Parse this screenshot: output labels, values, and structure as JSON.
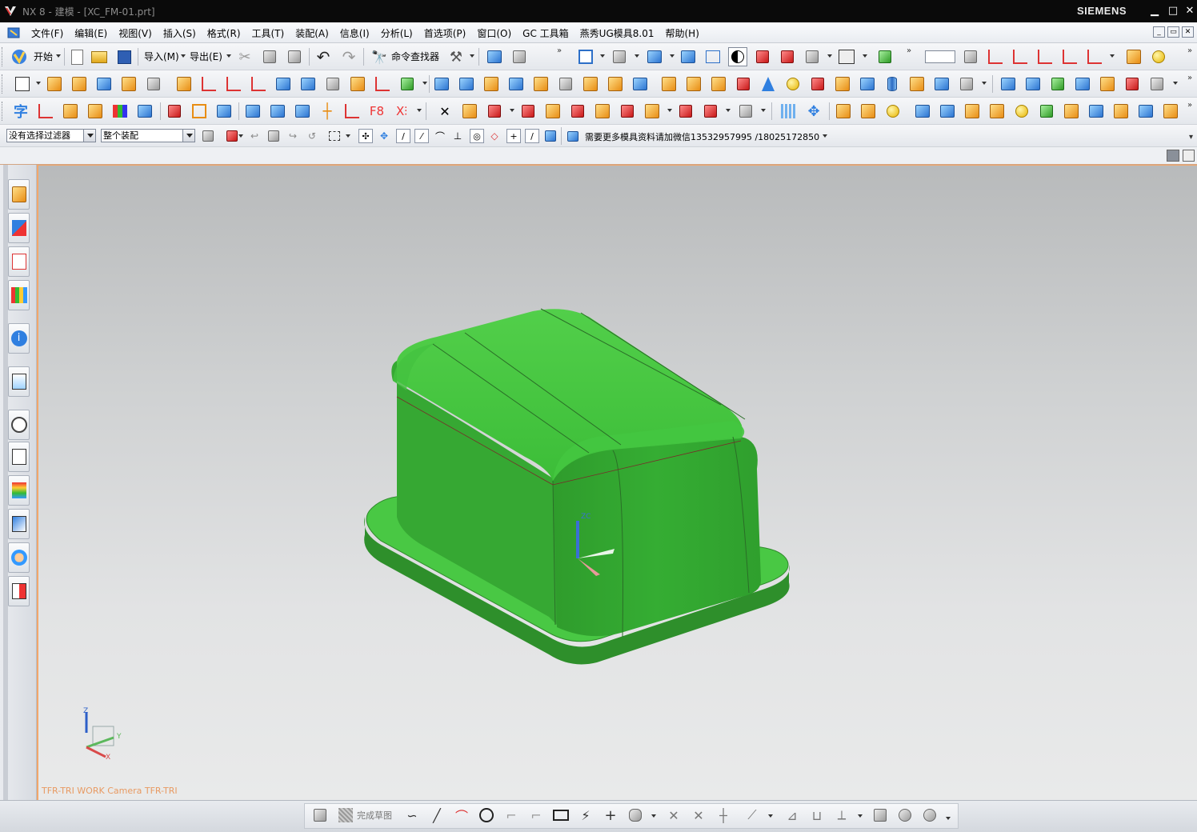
{
  "window": {
    "title": "NX 8 - 建模 - [XC_FM-01.prt]",
    "brand": "SIEMENS",
    "controls": [
      "minimize",
      "maximize",
      "close"
    ]
  },
  "menu": {
    "items": [
      "文件(F)",
      "编辑(E)",
      "视图(V)",
      "插入(S)",
      "格式(R)",
      "工具(T)",
      "装配(A)",
      "信息(I)",
      "分析(L)",
      "首选项(P)",
      "窗口(O)",
      "GC 工具箱",
      "燕秀UG模具8.01",
      "帮助(H)"
    ]
  },
  "toolbar_standard": {
    "start_label": "开始",
    "import_label": "导入(M)",
    "export_label": "导出(E)",
    "command_finder_label": "命令查找器"
  },
  "selection_bar": {
    "type_filter": "没有选择过滤器",
    "scope": "整个装配",
    "promo_text": "需要更多模具资料请加微信13532957995 /18025172850"
  },
  "viewport": {
    "camera_label": "TFR-TRI WORK Camera TFR-TRI",
    "triad_axes": [
      "Z",
      "Y",
      "X"
    ],
    "model_color": "#3cbb3b",
    "background_top": "#b8babb",
    "background_bottom": "#e9eaea",
    "border_color": "#f2a66a"
  },
  "sketch_bar": {
    "finish_sketch_label": "完成草图"
  },
  "icons": {
    "left_resource_bar": [
      "assembly-navigator-icon",
      "constraint-navigator-icon",
      "part-navigator-icon",
      "reuse-library-icon",
      "hd3d-tools-icon",
      "web-browser-icon",
      "history-icon",
      "process-studio-icon",
      "visualization-icon",
      "roles-icon",
      "system-materials-icon",
      "palette-icon"
    ]
  }
}
